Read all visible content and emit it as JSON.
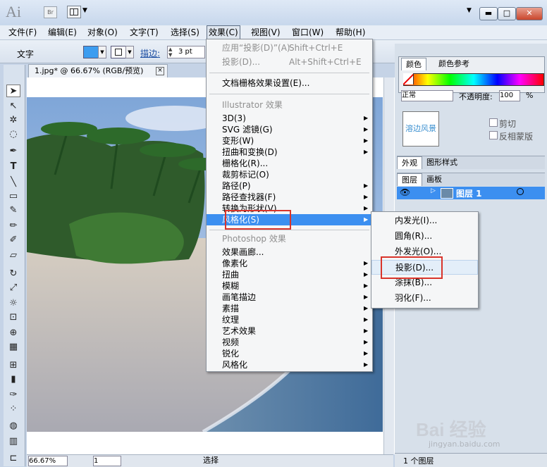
{
  "titlebar": {
    "logo": "Ai",
    "bridge_label": "Br"
  },
  "menubar": {
    "items": [
      "文件(F)",
      "编辑(E)",
      "对象(O)",
      "文字(T)",
      "选择(S)",
      "效果(C)",
      "视图(V)",
      "窗口(W)",
      "帮助(H)"
    ]
  },
  "controlbar": {
    "tool_label": "文字",
    "stroke_label": "描边:",
    "stroke_value": "3 pt"
  },
  "document": {
    "tab_label": "1.jpg* @ 66.67% (RGB/预览)",
    "close_icon": "×"
  },
  "statusbar": {
    "zoom": "66.67%",
    "page": "1",
    "status_text": "选择"
  },
  "effects_menu": {
    "apply_last": {
      "label": "应用“投影(D)”(A)",
      "shortcut": "Shift+Ctrl+E"
    },
    "last_effect": {
      "label": "投影(D)...",
      "shortcut": "Alt+Shift+Ctrl+E"
    },
    "doc_raster": "文档栅格效果设置(E)...",
    "illustrator_section": "Illustrator 效果",
    "illustrator_items": [
      "3D(3)",
      "SVG 滤镜(G)",
      "变形(W)",
      "扭曲和变换(D)",
      "栅格化(R)...",
      "裁剪标记(O)",
      "路径(P)",
      "路径查找器(F)",
      "转换为形状(V)",
      "风格化(S)"
    ],
    "photoshop_section": "Photoshop 效果",
    "photoshop_items": [
      "效果画廊...",
      "像素化",
      "扭曲",
      "模糊",
      "画笔描边",
      "素描",
      "纹理",
      "艺术效果",
      "视频",
      "锐化",
      "风格化"
    ]
  },
  "stylize_submenu": {
    "items": [
      "内发光(I)...",
      "圆角(R)...",
      "外发光(O)...",
      "投影(D)...",
      "涂抹(B)...",
      "羽化(F)..."
    ]
  },
  "panels": {
    "color_tab": "颜色",
    "guide_tab": "颜色参考",
    "blend_mode": "正常",
    "opacity_label": "不透明度:",
    "opacity_value": "100",
    "opacity_unit": "%",
    "thumb_text": "溶边风景",
    "clip_label": "剪切",
    "invert_label": "反相蒙版",
    "appearance_tab": "外观",
    "graphic_styles_tab": "图形样式",
    "layers_tab": "图层",
    "artboards_tab": "画板",
    "layer_name": "图层 1",
    "footer_count": "1 个图层"
  },
  "watermark": {
    "text": "Bai 经验",
    "sub": "jingyan.baidu.com"
  },
  "colors": {
    "highlight": "#3c8ff0",
    "red_box": "#d9342b",
    "fill": "#3c9df0"
  }
}
